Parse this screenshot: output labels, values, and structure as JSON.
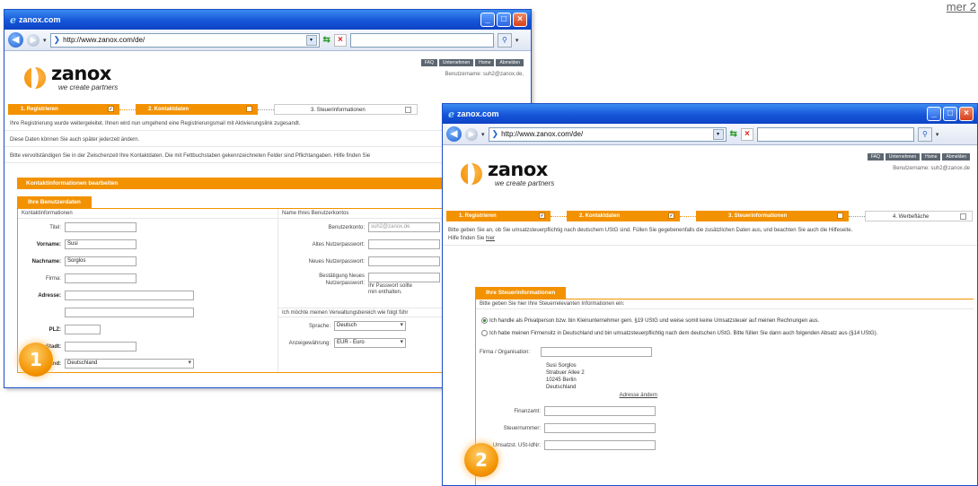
{
  "corner_text": "mer 2",
  "window1": {
    "title": "zanox.com",
    "url": "http://www.zanox.com/de/",
    "logo_word": "zanox",
    "logo_tag": "we create partners",
    "top_buttons": [
      "FAQ",
      "Unternehmen",
      "Home",
      "Abmelden"
    ],
    "user_line": "Benutzername: suh2@zanox.de,",
    "steps": [
      "1. Registrieren",
      "2. Kontaktdaten",
      "3. Steuerinformationen"
    ],
    "messages": [
      "Ihre Registrierung wurde weitergeleitet. Ihnen wird nun umgehend eine Registrierungsmail mit Aktivierungslink zugesandt.",
      "Diese Daten können Sie auch später jederzeit ändern.",
      "Bitte vervollständigen Sie in der Zwischenzeit Ihre Kontaktdaten. Die mit Fettbuchstaben gekennzeichneten Felder sind Pflichtangaben. Hilfe finden Sie"
    ],
    "panel_title": "Kontaktinformationen bearbeiten",
    "tab_label": "Ihre Benutzerdaten",
    "left_head": "Kontaktinformationen",
    "left_fields": [
      {
        "label": "Titel:",
        "value": ""
      },
      {
        "label": "Vorname:",
        "value": "Susi"
      },
      {
        "label": "Nachname:",
        "value": "Sorglos"
      },
      {
        "label": "Firma:",
        "value": ""
      },
      {
        "label": "Adresse:",
        "value": ""
      },
      {
        "label": "",
        "value": ""
      },
      {
        "label": "PLZ:",
        "value": ""
      },
      {
        "label": "Stadt:",
        "value": ""
      },
      {
        "label": "Land:",
        "value": "Deutschland"
      }
    ],
    "right_head": "Name Ihres Benutzerkontos",
    "right_fields": [
      {
        "label": "Benutzerkonto:",
        "value": "suh2@zanox.de"
      },
      {
        "label": "Altes Nutzerpasswort:",
        "value": ""
      },
      {
        "label": "Neues Nutzerpasswort:",
        "value": ""
      },
      {
        "label": "Bestätigung Neues Nutzerpasswort:",
        "value": "",
        "hint": "Ihr Passwort sollte min enthalten."
      }
    ],
    "right_head2": "Ich möchte meinen Verwaltungsbereich wie folgt führ",
    "right_fields2": [
      {
        "label": "Sprache:",
        "value": "Deutsch"
      },
      {
        "label": "Anzeigewährung:",
        "value": "EUR - Euro"
      }
    ],
    "badge": "1"
  },
  "window2": {
    "title": "zanox.com",
    "url": "http://www.zanox.com/de/",
    "logo_word": "zanox",
    "logo_tag": "we create partners",
    "top_buttons": [
      "FAQ",
      "Unternehmen",
      "Home",
      "Abmelden"
    ],
    "user_line": "Benutzername: suh2@zanox.de",
    "steps": [
      "1. Registrieren",
      "2. Kontaktdaten",
      "3. Steuerinformationen",
      "4. Werbefläche"
    ],
    "message1": "Bitte geben Sie an, ob Sie umsatzsteuerpflichtig nach deutschem UStG sind. Füllen Sie gegebenenfalls die zusätzlichen Daten aus, und beachten Sie auch die Hilfeseite.",
    "message2_prefix": "Hilfe finden Sie ",
    "message2_link": "hier",
    "tab_label": "Ihre Steuerinformationen",
    "intro": "Bitte geben Sie hier Ihre Steuerrelevanten Informationen ein:",
    "radio1": "Ich handle als Privatperson bzw. bin Kleinunternehmer gem. §19 UStG und weise somit keine Umsatzsteuer auf meinen Rechnungen aus.",
    "radio2": "Ich habe meinen Firmensitz in Deutschland und bin umsatzsteuerpflichtig nach dem deutschen UStG. Bitte füllen Sie dann auch folgenden Absatz aus (§14 UStG).",
    "firm_label": "Firma / Organisation:",
    "address_lines": [
      "Susi Sorglos",
      "Strabuer Allee 2",
      "10245 Berlin",
      "Deutschland"
    ],
    "address_link": "Adresse ändern",
    "finanzamt_label": "Finanzamt:",
    "steuernummer_label": "Steuernummer:",
    "ustid_label": "Umsatzst. USt-IdNr:",
    "badge": "2"
  }
}
